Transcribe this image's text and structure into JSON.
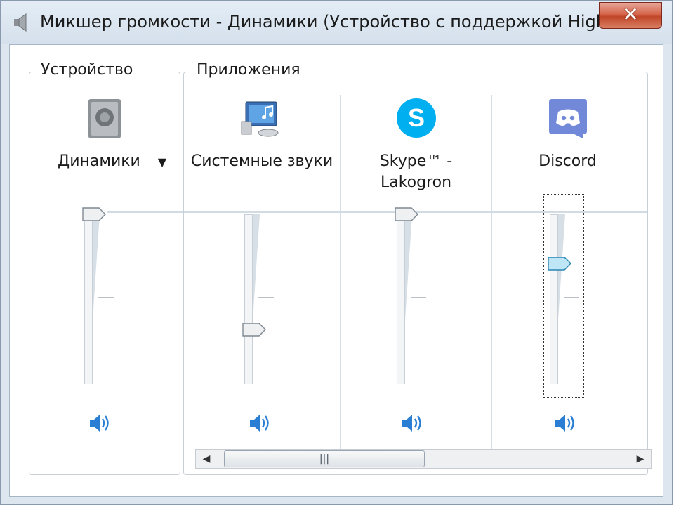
{
  "window": {
    "title": "Микшер громкости - Динамики (Устройство с поддержкой High Definit...",
    "close_label": "✕"
  },
  "device": {
    "group_label": "Устройство",
    "name": "Динамики",
    "dropdown_glyph": "▼",
    "volume": 1.0
  },
  "applications": {
    "group_label": "Приложения",
    "items": [
      {
        "name_line1": "Системные звуки",
        "name_line2": "",
        "volume": 0.3
      },
      {
        "name_line1": "Skype™ -",
        "name_line2": "Lakogron",
        "volume": 1.0
      },
      {
        "name_line1": "Discord",
        "name_line2": "",
        "volume": 0.7
      }
    ]
  },
  "scrollbar": {
    "left_arrow": "◀",
    "right_arrow": "▶",
    "grip": "|||"
  },
  "colors": {
    "accent_blue": "#2a7fd4",
    "skype_blue": "#00aff0",
    "discord_blurple": "#7289da",
    "close_red": "#c8452a"
  }
}
